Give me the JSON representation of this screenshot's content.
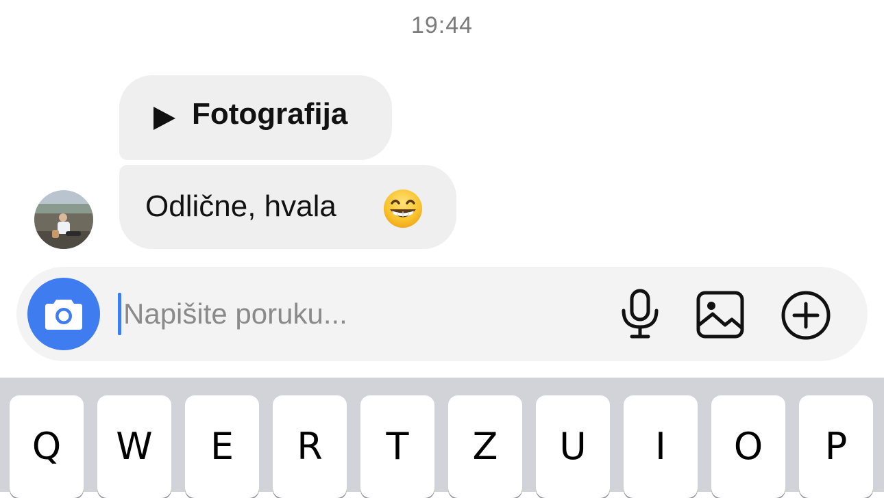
{
  "chat": {
    "timestamp": "19:44",
    "messages": [
      {
        "type": "photo",
        "label": "Fotografija"
      },
      {
        "type": "text",
        "text": "Odlične, hvala",
        "emoji": "grinning-face-with-smiling-eyes"
      }
    ]
  },
  "composer": {
    "placeholder": "Napišite poruku...",
    "value": ""
  },
  "keyboard": {
    "row1": [
      "Q",
      "W",
      "E",
      "R",
      "T",
      "Z",
      "U",
      "I",
      "O",
      "P"
    ]
  },
  "colors": {
    "accent": "#3e7cf0",
    "bubble": "#efefef",
    "keyboard_bg": "#d2d3d8"
  }
}
